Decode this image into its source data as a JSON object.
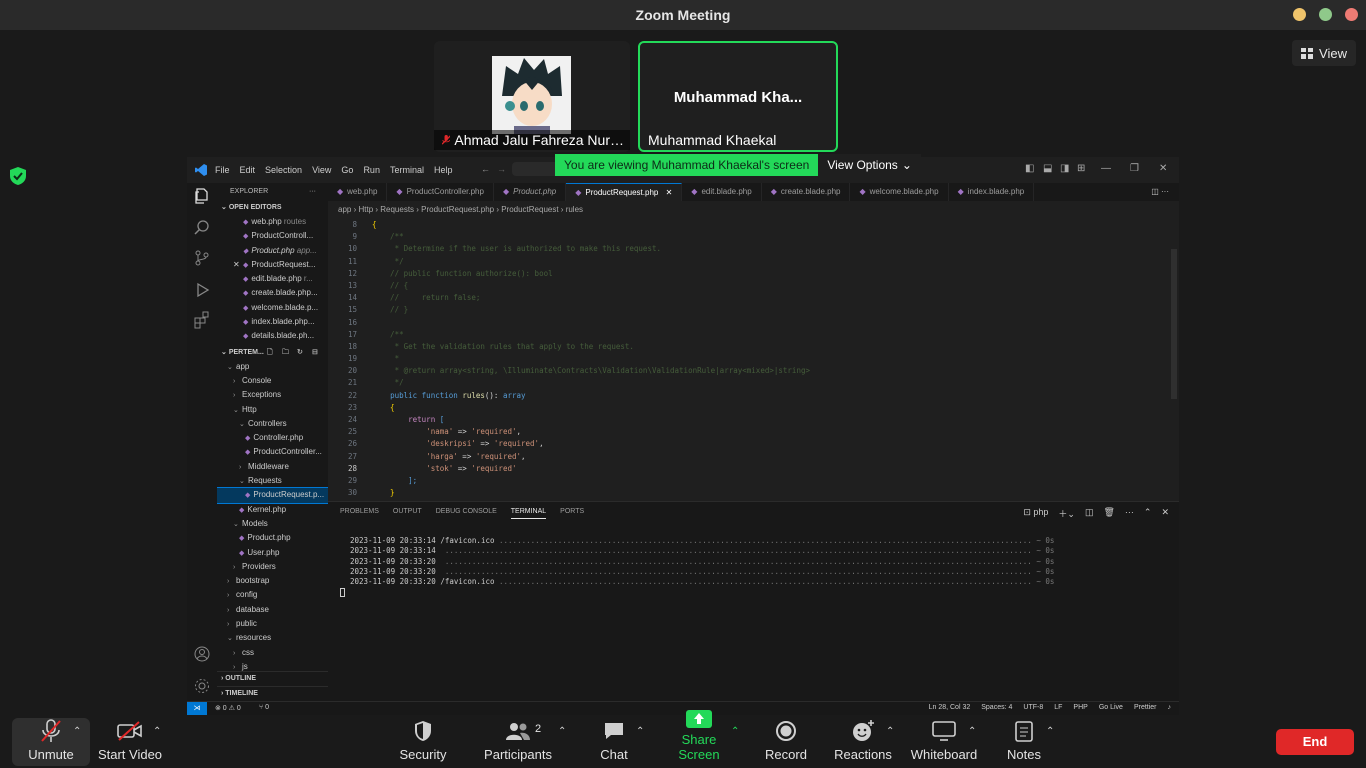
{
  "window": {
    "title": "Zoom Meeting",
    "view_label": "View"
  },
  "participants_tiles": [
    {
      "name": "Ahmad Jalu Fahreza Nur…"
    },
    {
      "name": "Muhammad Khaekal",
      "big_name": "Muhammad Kha..."
    }
  ],
  "share_banner": {
    "text": "You are viewing Muhammad Khaekal's screen",
    "options_label": "View Options"
  },
  "vscode": {
    "menu": [
      "File",
      "Edit",
      "Selection",
      "View",
      "Go",
      "Run",
      "Terminal",
      "Help"
    ],
    "sidebar": {
      "explorer_label": "EXPLORER",
      "open_editors_label": "OPEN EDITORS",
      "project_label": "PERTEM...",
      "outline_label": "OUTLINE",
      "timeline_label": "TIMELINE",
      "open_editors": [
        {
          "name": "web.php",
          "hint": "routes"
        },
        {
          "name": "ProductControll..."
        },
        {
          "name": "Product.php",
          "hint": "app..."
        },
        {
          "name": "ProductRequest..."
        },
        {
          "name": "edit.blade.php",
          "hint": "r..."
        },
        {
          "name": "create.blade.php..."
        },
        {
          "name": "welcome.blade.p..."
        },
        {
          "name": "index.blade.php..."
        },
        {
          "name": "details.blade.ph..."
        }
      ],
      "tree": [
        {
          "name": "app",
          "indent": 1,
          "type": "open"
        },
        {
          "name": "Console",
          "indent": 2,
          "type": "closed"
        },
        {
          "name": "Exceptions",
          "indent": 2,
          "type": "closed"
        },
        {
          "name": "Http",
          "indent": 2,
          "type": "open"
        },
        {
          "name": "Controllers",
          "indent": 3,
          "type": "open"
        },
        {
          "name": "Controller.php",
          "indent": 4,
          "type": "file"
        },
        {
          "name": "ProductController...",
          "indent": 4,
          "type": "file"
        },
        {
          "name": "Middleware",
          "indent": 3,
          "type": "closed"
        },
        {
          "name": "Requests",
          "indent": 3,
          "type": "open"
        },
        {
          "name": "ProductRequest.p...",
          "indent": 4,
          "type": "file",
          "selected": true
        },
        {
          "name": "Kernel.php",
          "indent": 3,
          "type": "file"
        },
        {
          "name": "Models",
          "indent": 2,
          "type": "open"
        },
        {
          "name": "Product.php",
          "indent": 3,
          "type": "file"
        },
        {
          "name": "User.php",
          "indent": 3,
          "type": "file"
        },
        {
          "name": "Providers",
          "indent": 2,
          "type": "closed"
        },
        {
          "name": "bootstrap",
          "indent": 1,
          "type": "closed"
        },
        {
          "name": "config",
          "indent": 1,
          "type": "closed"
        },
        {
          "name": "database",
          "indent": 1,
          "type": "closed"
        },
        {
          "name": "public",
          "indent": 1,
          "type": "closed"
        },
        {
          "name": "resources",
          "indent": 1,
          "type": "open"
        },
        {
          "name": "css",
          "indent": 2,
          "type": "closed"
        },
        {
          "name": "js",
          "indent": 2,
          "type": "closed"
        }
      ]
    },
    "tabs": [
      "web.php",
      "ProductController.php",
      "Product.php",
      "ProductRequest.php",
      "edit.blade.php",
      "create.blade.php",
      "welcome.blade.php",
      "index.blade.php"
    ],
    "active_tab": "ProductRequest.php",
    "breadcrumb": [
      "app",
      "Http",
      "Requests",
      "ProductRequest.php",
      "ProductRequest",
      "rules"
    ],
    "line_numbers": [
      "8",
      "9",
      "10",
      "11",
      "12",
      "13",
      "14",
      "15",
      "16",
      "17",
      "18",
      "19",
      "20",
      "21",
      "22",
      "23",
      "24",
      "25",
      "26",
      "27",
      "28",
      "29",
      "30"
    ],
    "code": [
      "{",
      "    /**",
      "     * Determine if the user is authorized to make this request.",
      "     */",
      "    // public function authorize(): bool",
      "    // {",
      "    //     return false;",
      "    // }",
      "",
      "    /**",
      "     * Get the validation rules that apply to the request.",
      "     *",
      "     * @return array<string, \\Illuminate\\Contracts\\Validation\\ValidationRule|array<mixed>|string>",
      "     */",
      "    public function rules(): array",
      "    {",
      "        return [",
      "            'nama' => 'required',",
      "            'deskripsi' => 'required',",
      "            'harga' => 'required',",
      "            'stok' => 'required'",
      "        ];",
      "    }"
    ],
    "panel_tabs": [
      "PROBLEMS",
      "OUTPUT",
      "DEBUG CONSOLE",
      "TERMINAL",
      "PORTS"
    ],
    "active_panel_tab": "TERMINAL",
    "terminal_shell": "php",
    "terminal": [
      {
        "ts": "2023-11-09 20:33:14",
        "path": "/favicon.ico",
        "dur": "~ 0s"
      },
      {
        "ts": "2023-11-09 20:33:14",
        "path": "",
        "dur": "~ 0s"
      },
      {
        "ts": "2023-11-09 20:33:20",
        "path": "",
        "dur": "~ 0s"
      },
      {
        "ts": "2023-11-09 20:33:20",
        "path": "",
        "dur": "~ 0s"
      },
      {
        "ts": "2023-11-09 20:33:20",
        "path": "/favicon.ico",
        "dur": "~ 0s"
      }
    ],
    "status": {
      "errors": "⊗ 0 ⚠ 0",
      "ports": "⑂ 0",
      "right": [
        "Ln 28, Col 32",
        "Spaces: 4",
        "UTF-8",
        "LF",
        "PHP",
        "Go Live",
        "Prettier"
      ]
    }
  },
  "toolbar": {
    "unmute": "Unmute",
    "start_video": "Start Video",
    "security": "Security",
    "participants": "Participants",
    "participants_count": "2",
    "chat": "Chat",
    "share_screen": "Share Screen",
    "record": "Record",
    "reactions": "Reactions",
    "whiteboard": "Whiteboard",
    "notes": "Notes",
    "end": "End"
  },
  "colors": {
    "accent_green": "#23d959",
    "end_red": "#e02828",
    "vscode_blue": "#0078d4"
  }
}
